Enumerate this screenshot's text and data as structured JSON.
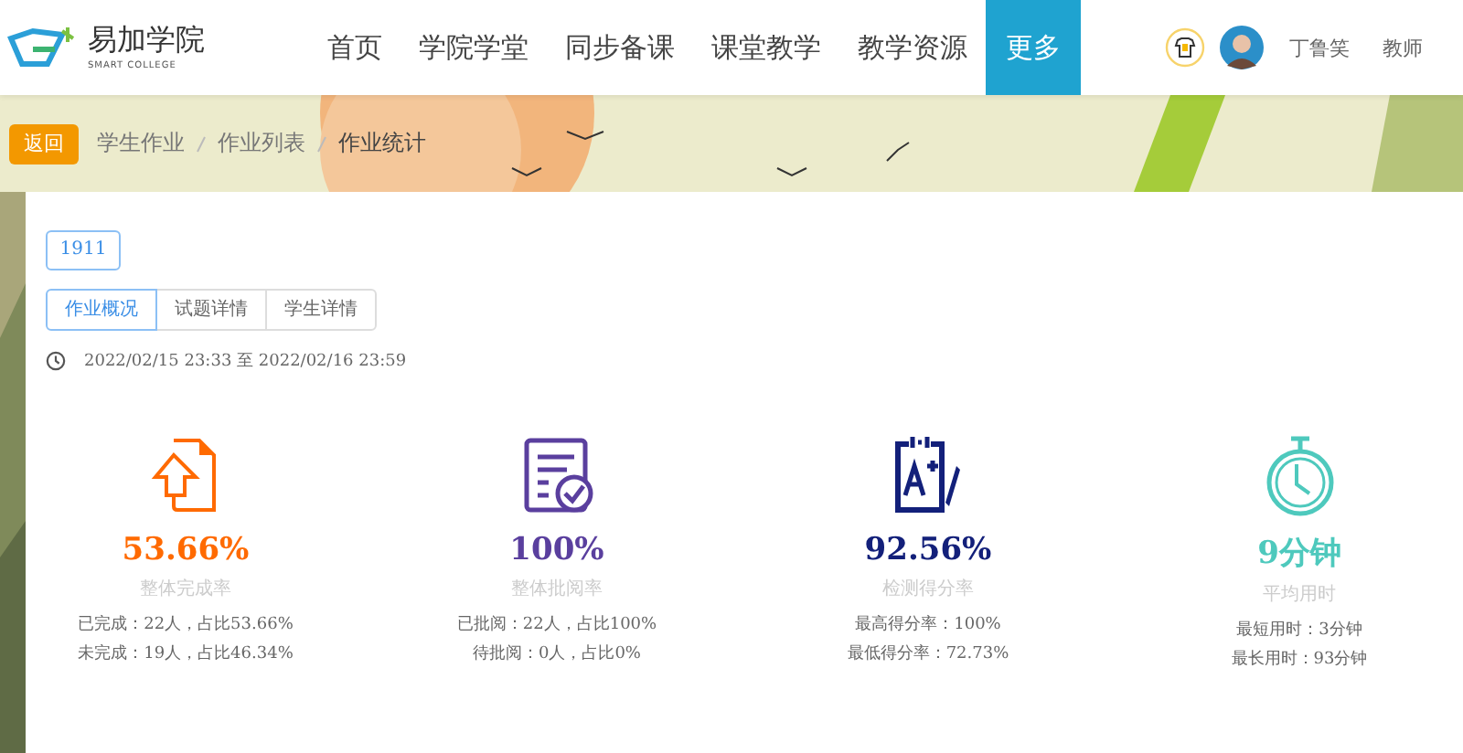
{
  "logo": {
    "name": "易加学院",
    "tagline": "SMART COLLEGE"
  },
  "nav": [
    {
      "label": "首页",
      "selected": false
    },
    {
      "label": "学院学堂",
      "selected": false
    },
    {
      "label": "同步备课",
      "selected": false
    },
    {
      "label": "课堂教学",
      "selected": false
    },
    {
      "label": "教学资源",
      "selected": false
    },
    {
      "label": "更多",
      "selected": true
    }
  ],
  "user": {
    "name": "丁鲁笑",
    "role": "教师"
  },
  "back_button": "返回",
  "breadcrumb": [
    "学生作业",
    "作业列表",
    "作业统计"
  ],
  "class_tag": "1911",
  "tabs": [
    {
      "label": "作业概况",
      "selected": true
    },
    {
      "label": "试题详情",
      "selected": false
    },
    {
      "label": "学生详情",
      "selected": false
    }
  ],
  "time_range": "2022/02/15 23:33 至 2022/02/16 23:59",
  "stats": [
    {
      "kind": "upload",
      "color": "#ff6a00",
      "value": "53.66%",
      "label": "整体完成率",
      "details": [
        "已完成：22人，占比53.66%",
        "未完成：19人，占比46.34%"
      ]
    },
    {
      "kind": "review",
      "color": "#5a3f9e",
      "value": "100%",
      "label": "整体批阅率",
      "details": [
        "已批阅：22人，占比100%",
        "待批阅：0人，占比0%"
      ]
    },
    {
      "kind": "grade",
      "color": "#13207a",
      "value": "92.56%",
      "label": "检测得分率",
      "details": [
        "最高得分率：100%",
        "最低得分率：72.73%"
      ]
    },
    {
      "kind": "timer",
      "color": "#4ec9bd",
      "value": "9分钟",
      "label": "平均用时",
      "details": [
        "最短用时：3分钟",
        "最长用时：93分钟"
      ]
    }
  ]
}
